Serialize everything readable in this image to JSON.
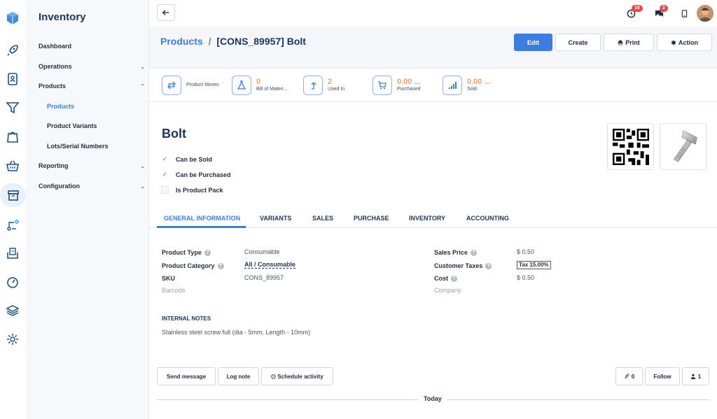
{
  "rail": {
    "icons": [
      "cube-icon",
      "rocket-icon",
      "contacts-icon",
      "funnel-icon",
      "shopping-bag-icon",
      "basket-icon",
      "inventory-box-icon",
      "route-icon",
      "invoice-icon",
      "speedometer-icon",
      "layers-icon",
      "settings-gear-icon"
    ],
    "active": "inventory-box-icon"
  },
  "sidebar": {
    "module": "Inventory",
    "items": [
      {
        "label": "Dashboard",
        "expandable": false
      },
      {
        "label": "Operations",
        "expandable": true
      },
      {
        "label": "Products",
        "expandable": true,
        "expanded": true
      },
      {
        "label": "Products",
        "sub": true,
        "active": true
      },
      {
        "label": "Product Variants",
        "sub": true
      },
      {
        "label": "Lots/Serial Numbers",
        "sub": true
      },
      {
        "label": "Reporting",
        "expandable": true
      },
      {
        "label": "Configuration",
        "expandable": true
      }
    ]
  },
  "topbar": {
    "activity_count": "10",
    "messages_count": "2"
  },
  "breadcrumb": {
    "parent": "Products",
    "separator": "/",
    "current": "[CONS_89957] Bolt"
  },
  "actions": {
    "edit": "Edit",
    "create": "Create",
    "print": "Print",
    "action": "Action"
  },
  "smart_buttons": [
    {
      "value": "",
      "label": "Product Moves",
      "icon": "arrows-exchange-icon"
    },
    {
      "value": "0",
      "label": "Bill of Materi...",
      "icon": "flask-icon"
    },
    {
      "value": "2",
      "label": "Used In",
      "icon": "level-up-icon"
    },
    {
      "value": "0.00 ...",
      "label": "Purchased",
      "icon": "cart-icon"
    },
    {
      "value": "0.00 ...",
      "label": "Sold",
      "icon": "signal-bars-icon"
    }
  ],
  "product": {
    "name": "Bolt",
    "can_be_sold": "Can be Sold",
    "can_be_purchased": "Can be Purchased",
    "is_pack": "Is Product Pack"
  },
  "tabs": [
    "GENERAL INFORMATION",
    "VARIANTS",
    "SALES",
    "PURCHASE",
    "INVENTORY",
    "ACCOUNTING"
  ],
  "fields": {
    "product_type_label": "Product Type",
    "product_type": "Consumable",
    "category_label": "Product Category",
    "category": "All / Consumable",
    "sku_label": "SKU",
    "sku": "CONS_89957",
    "barcode_label": "Barcode",
    "sales_price_label": "Sales Price",
    "sales_price": "$ 0.50",
    "customer_taxes_label": "Customer Taxes",
    "customer_taxes": "Tax 15.00%",
    "cost_label": "Cost",
    "cost": "$ 0.50",
    "company_label": "Company"
  },
  "notes": {
    "header": "INTERNAL NOTES",
    "text": "Stainless steel screw full (dia - 5mm, Length - 10mm)"
  },
  "chatter": {
    "send_message": "Send message",
    "log_note": "Log note",
    "schedule": "Schedule activity",
    "attachments": "0",
    "follow": "Follow",
    "followers": "1",
    "today": "Today"
  }
}
